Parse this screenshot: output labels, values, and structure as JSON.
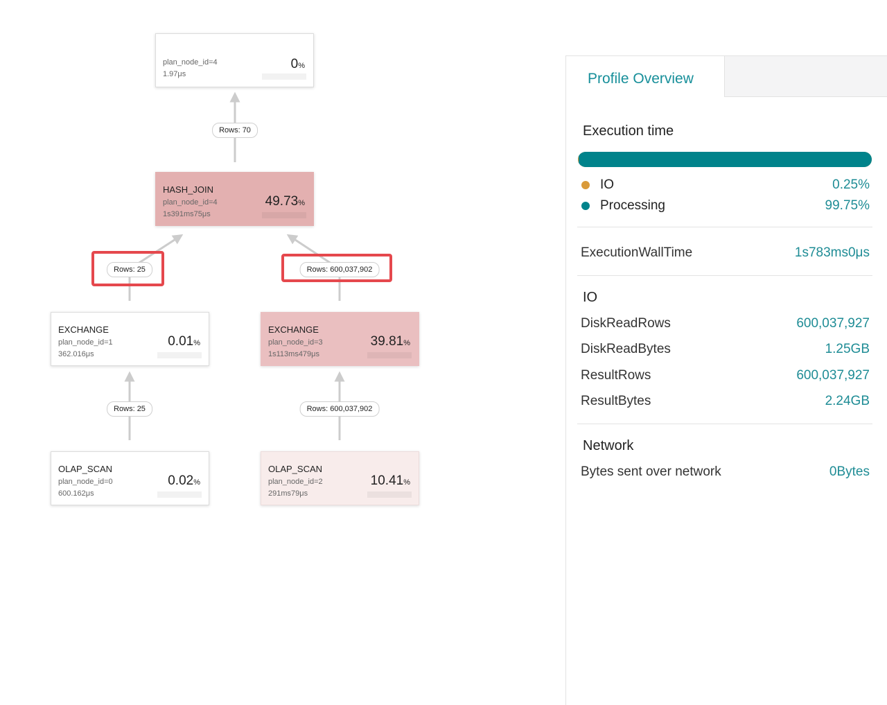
{
  "colors": {
    "accent": "#178f9a",
    "io": "#d99a3a",
    "processing": "#00838b",
    "highlight": "#e5484d",
    "node_high": "#e3b0b0",
    "node_mid": "#eabfc0",
    "node_low": "#f8eceb"
  },
  "plan": {
    "top_node": {
      "id": "plan_node_id=4",
      "time": "1.97μs",
      "pct": "0",
      "pct_unit": "%"
    },
    "hash_join": {
      "title": "HASH_JOIN",
      "id": "plan_node_id=4",
      "time": "1s391ms75μs",
      "pct": "49.73",
      "pct_unit": "%"
    },
    "exchange_left": {
      "title": "EXCHANGE",
      "id": "plan_node_id=1",
      "time": "362.016μs",
      "pct": "0.01",
      "pct_unit": "%"
    },
    "exchange_right": {
      "title": "EXCHANGE",
      "id": "plan_node_id=3",
      "time": "1s113ms479μs",
      "pct": "39.81",
      "pct_unit": "%"
    },
    "scan_left": {
      "title": "OLAP_SCAN",
      "id": "plan_node_id=0",
      "time": "600.162μs",
      "pct": "0.02",
      "pct_unit": "%"
    },
    "scan_right": {
      "title": "OLAP_SCAN",
      "id": "plan_node_id=2",
      "time": "291ms79μs",
      "pct": "10.41",
      "pct_unit": "%"
    },
    "edges": {
      "top": "Rows: 70",
      "join_left": "Rows: 25",
      "join_right": "Rows: 600,037,902",
      "scan_left": "Rows: 25",
      "scan_right": "Rows: 600,037,902"
    }
  },
  "panel": {
    "tab_label": "Profile Overview",
    "execution": {
      "title": "Execution time",
      "io_label": "IO",
      "io_value": "0.25%",
      "io_fraction": 0.0025,
      "processing_label": "Processing",
      "processing_value": "99.75%",
      "processing_fraction": 0.9975
    },
    "wall_time": {
      "label": "ExecutionWallTime",
      "value": "1s783ms0μs"
    },
    "io": {
      "title": "IO",
      "disk_read_rows": {
        "label": "DiskReadRows",
        "value": "600,037,927"
      },
      "disk_read_bytes": {
        "label": "DiskReadBytes",
        "value": "1.25GB"
      },
      "result_rows": {
        "label": "ResultRows",
        "value": "600,037,927"
      },
      "result_bytes": {
        "label": "ResultBytes",
        "value": "2.24GB"
      }
    },
    "network": {
      "title": "Network",
      "bytes_sent": {
        "label": "Bytes sent over network",
        "value": "0Bytes"
      }
    }
  }
}
